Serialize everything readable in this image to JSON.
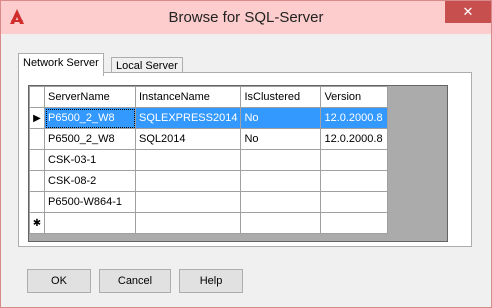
{
  "window": {
    "title": "Browse for SQL-Server",
    "app_icon": "red-a-logo-icon",
    "close_glyph": "✕"
  },
  "tabs": [
    {
      "label": "Network Server",
      "active": true
    },
    {
      "label": "Local Server",
      "active": false
    }
  ],
  "grid": {
    "columns": [
      "ServerName",
      "InstanceName",
      "IsClustered",
      "Version"
    ],
    "current_row_marker": "▶",
    "new_row_marker": "✱",
    "rows": [
      {
        "server": "P6500_2_W8",
        "instance": "SQLEXPRESS2014",
        "clustered": "No",
        "version": "12.0.2000.8",
        "selected": true
      },
      {
        "server": "P6500_2_W8",
        "instance": "SQL2014",
        "clustered": "No",
        "version": "12.0.2000.8",
        "selected": false
      },
      {
        "server": "CSK-03-1",
        "instance": "",
        "clustered": "",
        "version": "",
        "selected": false
      },
      {
        "server": "CSK-08-2",
        "instance": "",
        "clustered": "",
        "version": "",
        "selected": false
      },
      {
        "server": "P6500-W864-1",
        "instance": "",
        "clustered": "",
        "version": "",
        "selected": false
      }
    ]
  },
  "buttons": {
    "ok": "OK",
    "cancel": "Cancel",
    "help": "Help"
  },
  "colors": {
    "titlebar": "#fccdcc",
    "close": "#c7504f",
    "selection": "#3399ff"
  }
}
